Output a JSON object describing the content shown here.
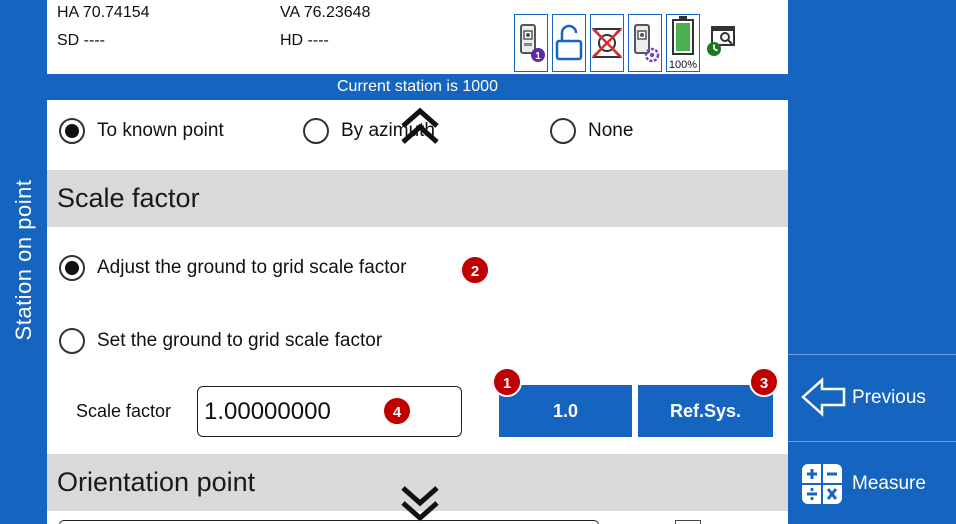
{
  "app": {
    "side_title": "Station on point"
  },
  "status": {
    "ha": "HA 70.74154",
    "va": "VA 76.23648",
    "sd": "SD ----",
    "hd": "HD ----",
    "battery": "100%",
    "prism_badge": "1",
    "station_banner": "Current station is 1000"
  },
  "icons": [
    "prism-icon",
    "unlock-icon",
    "no-target-icon",
    "prism-settings-icon",
    "battery-icon",
    "camera-clock-icon"
  ],
  "orientation": {
    "options": [
      {
        "label": "To known point",
        "selected": true
      },
      {
        "label": "By azimuth",
        "selected": false
      },
      {
        "label": "None",
        "selected": false
      }
    ]
  },
  "scale_section": {
    "title": "Scale factor",
    "adjust_label": "Adjust the ground to grid scale factor",
    "set_label": "Set the ground to grid scale factor",
    "adjust_selected": true,
    "field_label": "Scale factor",
    "field_value": "1.00000000",
    "btn_one": "1.0",
    "btn_refsys": "Ref.Sys."
  },
  "badges": {
    "b1": "1",
    "b2": "2",
    "b3": "3",
    "b4": "4"
  },
  "orientation_section": {
    "title": "Orientation point"
  },
  "right_panel": {
    "previous": "Previous",
    "measure": "Measure"
  },
  "colors": {
    "primary": "#1565C0",
    "badge": "#C00000",
    "section_bg": "#D9D9D9",
    "battery": "#4CAF50"
  }
}
